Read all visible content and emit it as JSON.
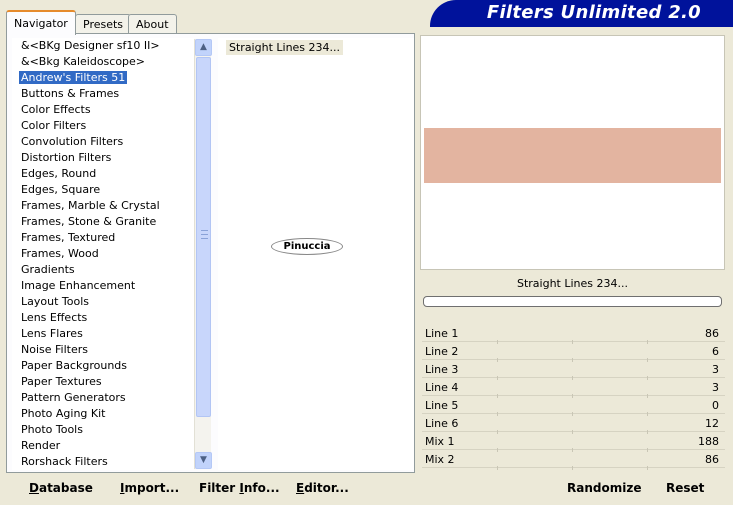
{
  "tabs": [
    {
      "label": "Navigator",
      "active": true
    },
    {
      "label": "Presets",
      "active": false
    },
    {
      "label": "About",
      "active": false
    }
  ],
  "app_title": "Filters Unlimited 2.0",
  "categories": [
    {
      "label": "&<BKg Designer sf10 II>",
      "selected": false
    },
    {
      "label": "&<Bkg Kaleidoscope>",
      "selected": false
    },
    {
      "label": "Andrew's Filters 51",
      "selected": true
    },
    {
      "label": "Buttons & Frames",
      "selected": false
    },
    {
      "label": "Color Effects",
      "selected": false
    },
    {
      "label": "Color Filters",
      "selected": false
    },
    {
      "label": "Convolution Filters",
      "selected": false
    },
    {
      "label": "Distortion Filters",
      "selected": false
    },
    {
      "label": "Edges, Round",
      "selected": false
    },
    {
      "label": "Edges, Square",
      "selected": false
    },
    {
      "label": "Frames, Marble & Crystal",
      "selected": false
    },
    {
      "label": "Frames, Stone & Granite",
      "selected": false
    },
    {
      "label": "Frames, Textured",
      "selected": false
    },
    {
      "label": "Frames, Wood",
      "selected": false
    },
    {
      "label": "Gradients",
      "selected": false
    },
    {
      "label": "Image Enhancement",
      "selected": false
    },
    {
      "label": "Layout Tools",
      "selected": false
    },
    {
      "label": "Lens Effects",
      "selected": false
    },
    {
      "label": "Lens Flares",
      "selected": false
    },
    {
      "label": "Noise Filters",
      "selected": false
    },
    {
      "label": "Paper Backgrounds",
      "selected": false
    },
    {
      "label": "Paper Textures",
      "selected": false
    },
    {
      "label": "Pattern Generators",
      "selected": false
    },
    {
      "label": "Photo Aging Kit",
      "selected": false
    },
    {
      "label": "Photo Tools",
      "selected": false
    },
    {
      "label": "Render",
      "selected": false
    },
    {
      "label": "Rorshack Filters",
      "selected": false
    }
  ],
  "filters": [
    "Straight Lines 234..."
  ],
  "watermark": "Pinuccia",
  "preview": {
    "swatch_color": "#e3b4a0"
  },
  "current_filter_name": "Straight Lines 234...",
  "progress": 0,
  "params": [
    {
      "name": "Line 1",
      "value": "86",
      "level": 0.337
    },
    {
      "name": "Line 2",
      "value": "6",
      "level": null
    },
    {
      "name": "Line 3",
      "value": "3",
      "level": null
    },
    {
      "name": "Line 4",
      "value": "3",
      "level": null
    },
    {
      "name": "Line 5",
      "value": "0",
      "level": null
    },
    {
      "name": "Line 6",
      "value": "12",
      "level": null
    },
    {
      "name": "Mix 1",
      "value": "188",
      "level": 0.737
    },
    {
      "name": "Mix 2",
      "value": "86",
      "level": 0.337
    }
  ],
  "buttons": {
    "database": {
      "first": "D",
      "rest": "atabase"
    },
    "import": {
      "first": "I",
      "rest": "mport..."
    },
    "filter_info": {
      "pre": "Filter ",
      "first": "I",
      "rest": "nfo..."
    },
    "editor": {
      "first": "E",
      "rest": "ditor..."
    },
    "randomize": "Randomize",
    "reset": "Reset"
  },
  "scroll_arrows": {
    "up": "▲",
    "down": "▼"
  }
}
